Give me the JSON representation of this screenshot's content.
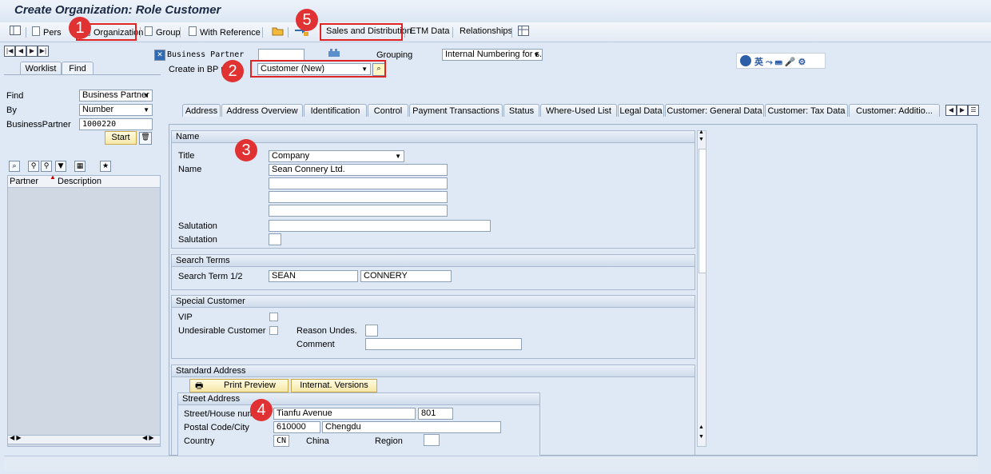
{
  "window": {
    "title": "Create Organization: Role Customer"
  },
  "toolbar": {
    "person": "Pers",
    "organization": "Organization",
    "group": "Group",
    "with_reference": "With Reference",
    "sales": "Sales and Distribution",
    "etm": "ETM Data",
    "relationships": "Relationships"
  },
  "badges": {
    "b1": "1",
    "b2": "2",
    "b3": "3",
    "b4": "4",
    "b5": "5"
  },
  "header": {
    "bp_label": "Business Partner",
    "bp_value": "",
    "grouping_label": "Grouping",
    "grouping_value": "Internal Numbering for s...",
    "role_label": "Create in BP rol",
    "role_value": "Customer (New)"
  },
  "left": {
    "tab_worklist": "Worklist",
    "tab_find": "Find",
    "find_label": "Find",
    "find_value": "Business Partner",
    "by_label": "By",
    "by_value": "Number",
    "bp_label": "BusinessPartner",
    "bp_value": "1000220",
    "start": "Start",
    "col_partner": "Partner",
    "col_description": "Description"
  },
  "tabs": [
    "Address",
    "Address Overview",
    "Identification",
    "Control",
    "Payment Transactions",
    "Status",
    "Where-Used List",
    "Legal Data",
    "Customer: General Data",
    "Customer: Tax Data",
    "Customer: Additio..."
  ],
  "name_group": {
    "heading": "Name",
    "title_label": "Title",
    "title_value": "Company",
    "name_label": "Name",
    "name1": "Sean Connery Ltd.",
    "salutation_label": "Salutation",
    "salutation2_label": "Salutation"
  },
  "search_group": {
    "heading": "Search Terms",
    "label": "Search Term 1/2",
    "term1": "SEAN",
    "term2": "CONNERY"
  },
  "special_group": {
    "heading": "Special Customer",
    "vip": "VIP",
    "undesirable": "Undesirable Customer",
    "reason": "Reason Undes.",
    "comment": "Comment"
  },
  "address_group": {
    "heading": "Standard Address",
    "print_preview": "Print Preview",
    "internat": "Internat. Versions",
    "street_heading": "Street Address",
    "street_label": "Street/House numb",
    "street_value": "Tianfu Avenue",
    "house_no": "801",
    "postal_label": "Postal Code/City",
    "postal_value": "610000",
    "city_value": "Chengdu",
    "country_label": "Country",
    "country_code": "CN",
    "country_name": "China",
    "region_label": "Region"
  }
}
